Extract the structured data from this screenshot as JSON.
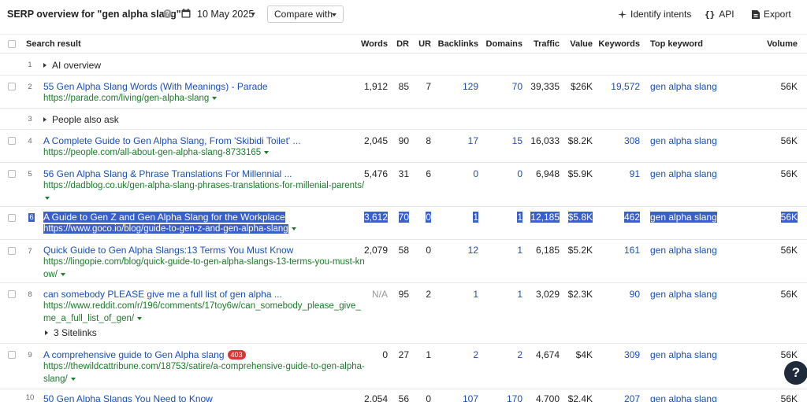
{
  "toolbar": {
    "title": "SERP overview for \"gen alpha slang\"",
    "help": "?",
    "date": "10 May 2025",
    "compare_label": "Compare with",
    "identify_label": "Identify intents",
    "api_label": "API",
    "export_label": "Export"
  },
  "columns": {
    "search_result": "Search result",
    "words": "Words",
    "dr": "DR",
    "ur": "UR",
    "backlinks": "Backlinks",
    "domains": "Domains",
    "traffic": "Traffic",
    "value": "Value",
    "keywords": "Keywords",
    "top_keyword": "Top keyword",
    "volume": "Volume"
  },
  "rows": [
    {
      "num": "1",
      "expander": "AI overview"
    },
    {
      "num": "2",
      "title": "55 Gen Alpha Slang Words (With Meanings) - Parade",
      "url1": "https://parade.com/living/gen-alpha-slang",
      "words": "1,912",
      "dr": "85",
      "ur": "7",
      "backlinks": "129",
      "domains": "70",
      "traffic": "39,335",
      "value": "$26K",
      "keywords": "19,572",
      "top_keyword": "gen alpha slang",
      "volume": "56K"
    },
    {
      "num": "3",
      "expander": "People also ask"
    },
    {
      "num": "4",
      "title": "A Complete Guide to Gen Alpha Slang, From 'Skibidi Toilet' ...",
      "url1": "https://people.com/all-about-gen-alpha-slang-8733165",
      "words": "2,045",
      "dr": "90",
      "ur": "8",
      "backlinks": "17",
      "domains": "15",
      "traffic": "16,033",
      "value": "$8.2K",
      "keywords": "308",
      "top_keyword": "gen alpha slang",
      "volume": "56K"
    },
    {
      "num": "5",
      "title": "56 Gen Alpha Slang & Phrase Translations For Millennial ...",
      "url1": "https://dadblog.co.uk/gen-alpha-slang-phrases-translations-for-millenial-parents/",
      "words": "5,476",
      "dr": "31",
      "ur": "6",
      "backlinks": "0",
      "domains": "0",
      "traffic": "6,948",
      "value": "$5.9K",
      "keywords": "91",
      "top_keyword": "gen alpha slang",
      "volume": "56K"
    },
    {
      "num": "6",
      "title": "A Guide to Gen Z and Gen Alpha Slang for the Workplace",
      "url1": "https://www.goco.io/blog/guide-to-gen-z-and-gen-alpha-slang",
      "words": "3,612",
      "dr": "70",
      "ur": "0",
      "backlinks": "1",
      "domains": "1",
      "traffic": "12,185",
      "value": "$5.8K",
      "keywords": "462",
      "top_keyword": "gen alpha slang",
      "volume": "56K"
    },
    {
      "num": "7",
      "title": "Quick Guide to Gen Alpha Slangs:13 Terms You Must Know",
      "url1": "https://lingopie.com/blog/quick-guide-to-gen-alpha-slangs-13-terms-you-must-kn",
      "url2": "ow/",
      "words": "2,079",
      "dr": "58",
      "ur": "0",
      "backlinks": "12",
      "domains": "1",
      "traffic": "6,185",
      "value": "$5.2K",
      "keywords": "161",
      "top_keyword": "gen alpha slang",
      "volume": "56K"
    },
    {
      "num": "8",
      "title": "can somebody PLEASE give me a full list of gen alpha ...",
      "url1": "https://www.reddit.com/r/196/comments/17toy6w/can_somebody_please_give_",
      "url2": "me_a_full_list_of_gen/",
      "words": "N/A",
      "dr": "95",
      "ur": "2",
      "backlinks": "1",
      "domains": "1",
      "traffic": "3,029",
      "value": "$2.3K",
      "keywords": "90",
      "top_keyword": "gen alpha slang",
      "volume": "56K",
      "sitelinks": "3 Sitelinks"
    },
    {
      "num": "9",
      "title": "A comprehensive guide to Gen Alpha slang",
      "badge": "403",
      "url1": "https://thewildcattribune.com/18753/satire/a-comprehensive-guide-to-gen-alpha-",
      "url2": "slang/",
      "words": "0",
      "dr": "27",
      "ur": "1",
      "backlinks": "2",
      "domains": "2",
      "traffic": "4,674",
      "value": "$4K",
      "keywords": "309",
      "top_keyword": "gen alpha slang",
      "volume": "56K"
    },
    {
      "num": "10",
      "title": "50 Gen Alpha Slangs You Need to Know",
      "words": "2,054",
      "dr": "56",
      "ur": "0",
      "backlinks": "107",
      "domains": "170",
      "traffic": "4,700",
      "value": "$2.4K",
      "keywords": "207",
      "top_keyword": "gen alpha slang",
      "volume": "56K"
    }
  ],
  "fab": "?"
}
